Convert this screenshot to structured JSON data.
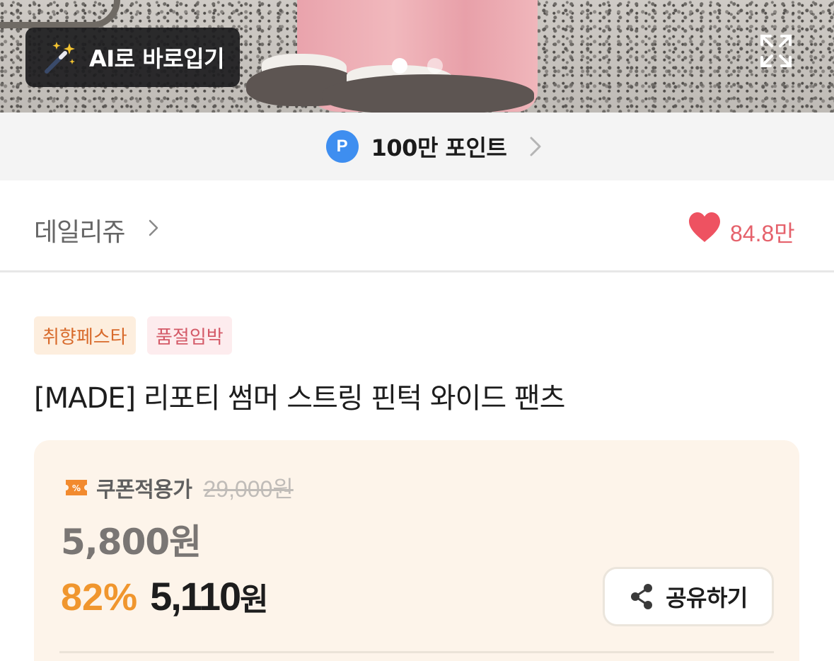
{
  "hero": {
    "ai_button_label": "AI로 바로입기",
    "carousel_total": 2,
    "carousel_active_index": 0
  },
  "points_banner": {
    "badge_letter": "P",
    "text": "100만 포인트"
  },
  "shop": {
    "name": "데일리쥬",
    "like_count": "84.8만"
  },
  "badges": [
    "취향페스타",
    "품절임박"
  ],
  "product": {
    "title": "[MADE] 리포티 썸머 스트링 핀턱 와이드 팬츠"
  },
  "pricing": {
    "coupon_label": "쿠폰적용가",
    "original_price": "29,000원",
    "coupon_price": "5,800원",
    "discount_rate": "82%",
    "final_price": "5,110",
    "currency": "원",
    "share_label": "공유하기"
  },
  "colors": {
    "accent_orange": "#f0962e",
    "heart_red": "#e5616b",
    "points_blue": "#3e8ef0",
    "price_box_bg": "#fdf4ea"
  },
  "icons": {
    "ai": "magic-wand-icon",
    "expand": "expand-icon",
    "heart": "heart-icon",
    "coupon": "coupon-icon",
    "share": "share-icon"
  }
}
